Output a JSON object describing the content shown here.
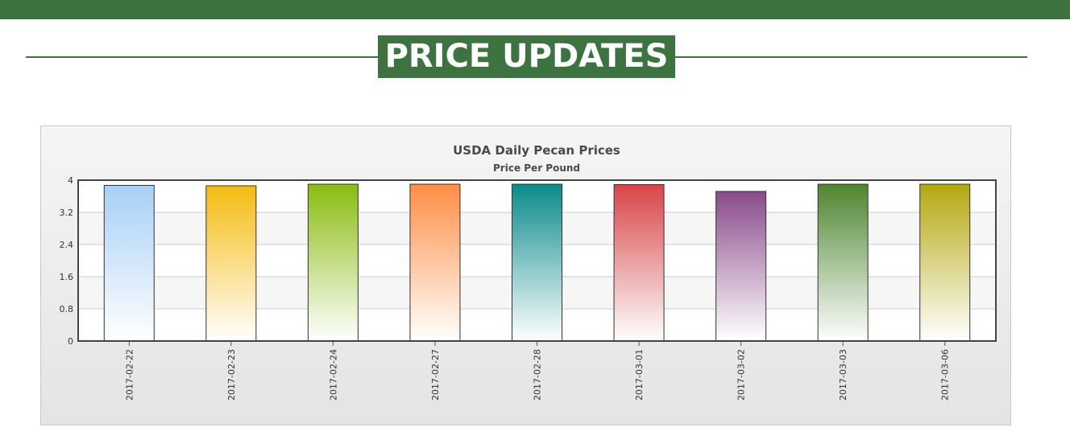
{
  "page": {
    "heading": "PRICE UPDATES"
  },
  "colors": {
    "brand_green": "#3d7340"
  },
  "chart_data": {
    "type": "bar",
    "title": "USDA Daily Pecan Prices",
    "subtitle": "Price Per Pound",
    "xlabel": "",
    "ylabel": "",
    "categories": [
      "2017-02-22",
      "2017-02-23",
      "2017-02-24",
      "2017-02-27",
      "2017-02-28",
      "2017-03-01",
      "2017-03-02",
      "2017-03-03",
      "2017-03-06"
    ],
    "values": [
      3.87,
      3.86,
      3.9,
      3.9,
      3.9,
      3.89,
      3.72,
      3.9,
      3.9
    ],
    "ylim": [
      0,
      4
    ],
    "yticks": [
      "0",
      "0.8",
      "1.6",
      "2.4",
      "3.2",
      "4"
    ],
    "grid": true,
    "legend": "none",
    "bar_colors": [
      "#a7d0f5",
      "#f5bb10",
      "#8abc10",
      "#ff8e45",
      "#0a8a8a",
      "#d84448",
      "#8a4a8a",
      "#4f8530",
      "#b4a810"
    ]
  }
}
